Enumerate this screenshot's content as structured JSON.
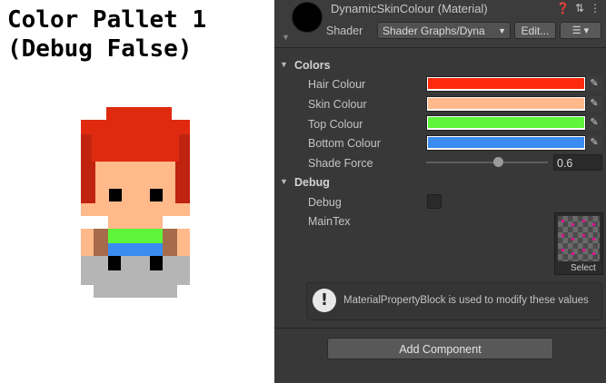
{
  "caption": {
    "line1": "Color Pallet 1",
    "line2": "(Debug False)"
  },
  "inspector": {
    "title": "DynamicSkinColour (Material)",
    "header_icons": [
      "help-icon",
      "preset-icon",
      "more-icon"
    ],
    "shader_label": "Shader",
    "shader_value": "Shader Graphs/Dyna",
    "edit_label": "Edit...",
    "list_label": "☰ ▾",
    "colors_section": "Colors",
    "properties": [
      {
        "label": "Hair Colour",
        "color": "#ff2a0e"
      },
      {
        "label": "Skin Colour",
        "color": "#ffb98a"
      },
      {
        "label": "Top Colour",
        "color": "#5ef53a"
      },
      {
        "label": "Bottom Colour",
        "color": "#3b8cf0"
      }
    ],
    "shade_label": "Shade Force",
    "shade_value": "0.6",
    "shade_fraction": 0.6,
    "debug_section": "Debug",
    "debug_label": "Debug",
    "debug_checked": false,
    "maintex_label": "MainTex",
    "select_label": "Select",
    "info_text": "MaterialPropertyBlock is used to modify these values",
    "info_icon": "!",
    "add_component_label": "Add Component"
  },
  "sprite": {
    "hair": "#e02a10",
    "hair_dark": "#c02410",
    "skin": "#ffb98a",
    "top": "#5ef53a",
    "bottom": "#3b8cf0",
    "pants": "#b5b5b5",
    "shade": "#a66b4a",
    "eyes": "#000000"
  }
}
